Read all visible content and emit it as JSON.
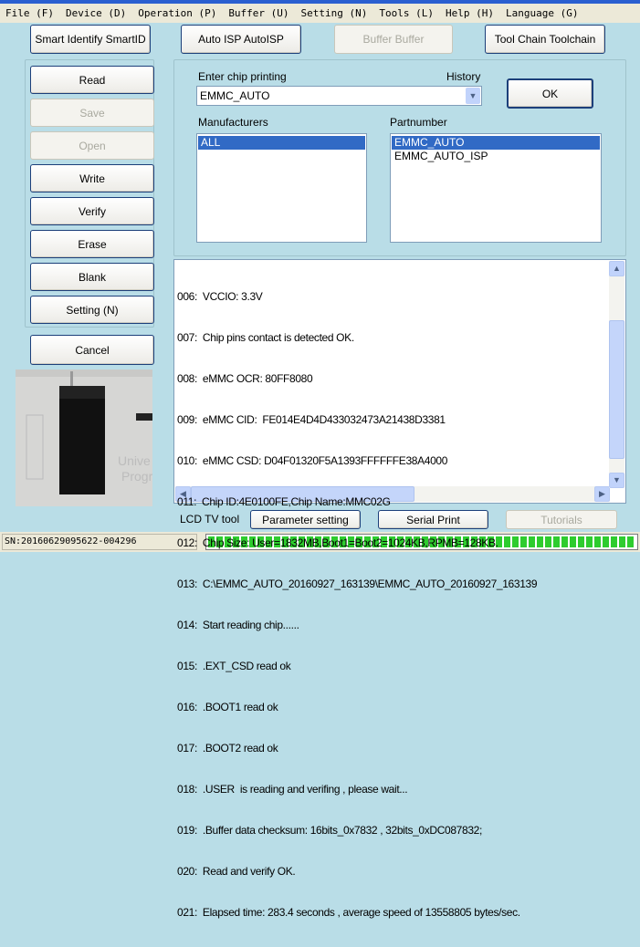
{
  "menu": [
    "File (F)",
    "Device (D)",
    "Operation (P)",
    "Buffer (U)",
    "Setting (N)",
    "Tools (L)",
    "Help (H)",
    "Language (G)"
  ],
  "toolbar": {
    "smart_id": "Smart Identify SmartID",
    "auto_isp": "Auto ISP AutoISP",
    "buffer": "Buffer Buffer",
    "toolchain": "Tool Chain Toolchain"
  },
  "ops": {
    "read": "Read",
    "save": "Save",
    "open": "Open",
    "write": "Write",
    "verify": "Verify",
    "erase": "Erase",
    "blank": "Blank",
    "setting": "Setting (N)",
    "cancel": "Cancel"
  },
  "chip": {
    "enter_label": "Enter chip printing",
    "history_label": "History",
    "value": "EMMC_AUTO",
    "ok": "OK",
    "manufacturers_label": "Manufacturers",
    "manufacturers": [
      "ALL"
    ],
    "partnumber_label": "Partnumber",
    "partnumbers": [
      "EMMC_AUTO",
      "EMMC_AUTO_ISP"
    ]
  },
  "log": [
    "006:  VCCIO: 3.3V",
    "007:  Chip pins contact is detected OK.",
    "008:  eMMC OCR: 80FF8080",
    "009:  eMMC CID:  FE014E4D4D433032473A21438D3381",
    "010:  eMMC CSD: D04F01320F5A1393FFFFFFE38A4000",
    "011:  Chip ID:4E0100FE,Chip Name:MMC02G",
    "012:  Chip Size: User=1832MB,Boot1=Boot2=1024KB,RPMB=128KB.",
    "013:  C:\\EMMC_AUTO_20160927_163139\\EMMC_AUTO_20160927_163139",
    "014:  Start reading chip......",
    "015:  .EXT_CSD read ok",
    "016:  .BOOT1 read ok",
    "017:  .BOOT2 read ok",
    "018:  .USER  is reading and verifing , please wait...",
    "019:  .Buffer data checksum: 16bits_0x7832 , 32bits_0xDC087832;",
    "020:  Read and verify OK.",
    "021:  Elapsed time: 283.4 seconds , average speed of 13558805 bytes/sec."
  ],
  "bottom": {
    "lcd_label": "LCD TV tool",
    "param": "Parameter setting",
    "serial": "Serial Print",
    "tutorials": "Tutorials"
  },
  "status": {
    "sn": "SN:20160629095622-004296",
    "progress_percent": 100,
    "progress_color": "#2ecc2e"
  }
}
